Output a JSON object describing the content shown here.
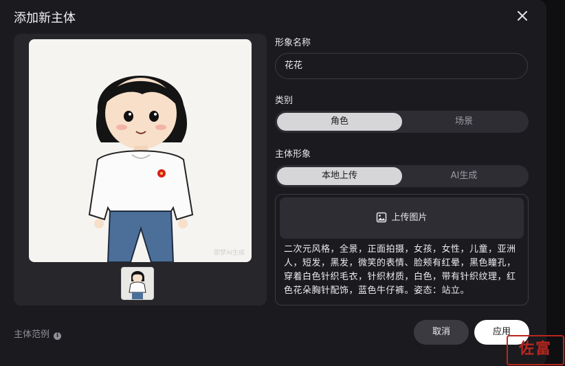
{
  "dialog": {
    "title": "添加新主体",
    "close_icon": "close-icon"
  },
  "preview": {
    "watermark": "即梦AI生成"
  },
  "form": {
    "name_label": "形象名称",
    "name_value": "花花",
    "category_label": "类别",
    "category_options": [
      "角色",
      "场景"
    ],
    "category_selected": "角色",
    "subject_label": "主体形象",
    "subject_options": [
      "本地上传",
      "AI生成"
    ],
    "subject_selected": "本地上传",
    "upload_label": "上传图片",
    "upload_icon": "image-icon",
    "description": "二次元风格，全景，正面拍摄，女孩，女性，儿童，亚洲人，短发，黑发，微笑的表情、脸颊有红晕，黑色瞳孔，穿着白色针织毛衣，针织材质，白色，带有针织纹理，红色花朵胸针配饰，蓝色牛仔裤。姿态：站立。"
  },
  "footer": {
    "example_label": "主体范例",
    "info_icon": "info-icon",
    "cancel_label": "取消",
    "apply_label": "应用"
  },
  "seal_text": "佐富"
}
